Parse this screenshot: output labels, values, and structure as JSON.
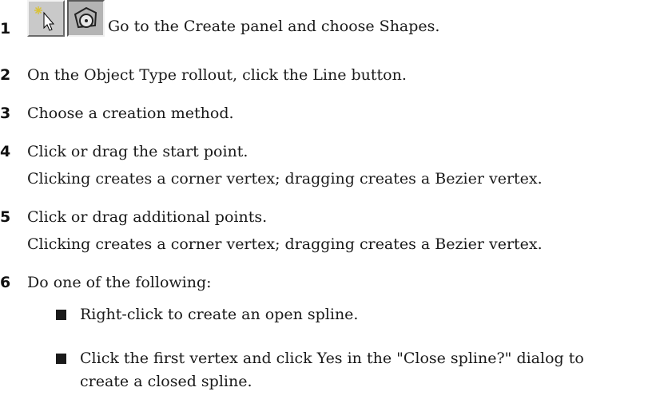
{
  "steps": [
    {
      "number": "1",
      "text": "Go to the Create panel and choose Shapes.",
      "icons": [
        "create-panel-icon",
        "shapes-icon"
      ]
    },
    {
      "number": "2",
      "text": "On the Object Type rollout, click the Line button."
    },
    {
      "number": "3",
      "text": "Choose a creation method."
    },
    {
      "number": "4",
      "text": "Click or drag the start point.",
      "detail": "Clicking creates a corner vertex; dragging creates a Bezier vertex."
    },
    {
      "number": "5",
      "text": "Click or drag additional points.",
      "detail": "Clicking creates a corner vertex; dragging creates a Bezier vertex."
    },
    {
      "number": "6",
      "text": "Do one of the following:",
      "bullets": [
        [
          "Right-click to create an open spline."
        ],
        [
          "Click the first vertex and click Yes in the \"Close spline?\" dialog to",
          "create a closed spline."
        ]
      ]
    }
  ],
  "colors": {
    "text": "#1a1a1a",
    "button_face": "#c9c9c9"
  }
}
